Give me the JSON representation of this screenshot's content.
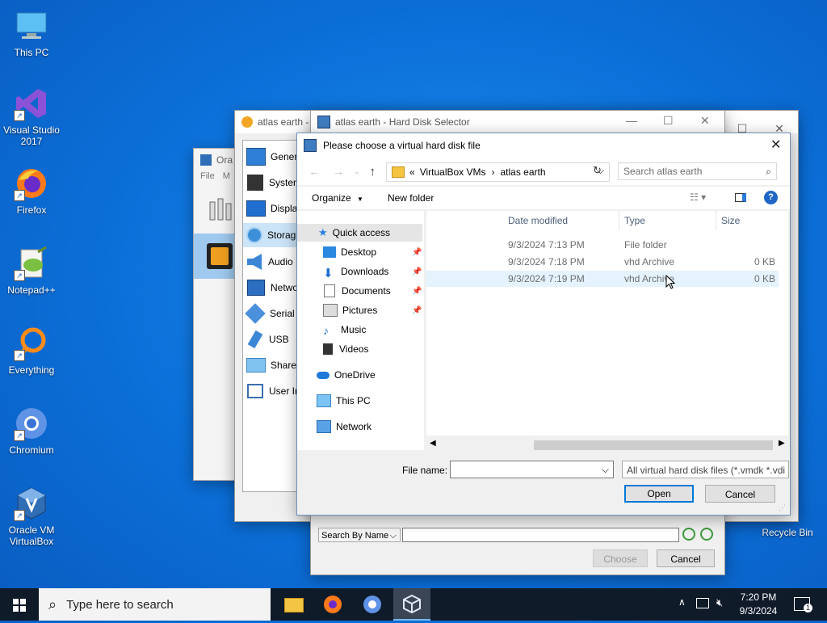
{
  "desktop": {
    "icons": [
      {
        "label": "This PC"
      },
      {
        "label": "Visual Studio 2017"
      },
      {
        "label": "Firefox"
      },
      {
        "label": "Notepad++"
      },
      {
        "label": "Everything"
      },
      {
        "label": "Chromium"
      },
      {
        "label": "Oracle VM VirtualBox"
      },
      {
        "label": "Recycle Bin"
      }
    ]
  },
  "vbox_manager": {
    "title": "Ora",
    "menu_file": "File",
    "menu_m": "M"
  },
  "settings_window": {
    "title": "atlas earth -",
    "sections": [
      "Genera",
      "System",
      "Display",
      "Storag",
      "Audio",
      "Netwo",
      "Serial P",
      "USB",
      "Shared",
      "User Ir"
    ]
  },
  "selector_window": {
    "title": "atlas earth - Hard Disk Selector",
    "search_mode": "Search By Name",
    "choose_label": "Choose",
    "cancel_label": "Cancel"
  },
  "dialog": {
    "title": "Please choose a virtual hard disk file",
    "breadcrumb": [
      "VirtualBox VMs",
      "atlas earth"
    ],
    "breadcrumb_prefix": "«",
    "search_placeholder": "Search atlas earth",
    "organize_label": "Organize",
    "new_folder_label": "New folder",
    "nav": [
      {
        "label": "Quick access"
      },
      {
        "label": "Desktop"
      },
      {
        "label": "Downloads"
      },
      {
        "label": "Documents"
      },
      {
        "label": "Pictures"
      },
      {
        "label": "Music"
      },
      {
        "label": "Videos"
      },
      {
        "label": "OneDrive"
      },
      {
        "label": "This PC"
      },
      {
        "label": "Network"
      }
    ],
    "columns": {
      "date": "Date modified",
      "type": "Type",
      "size": "Size"
    },
    "files": [
      {
        "date": "9/3/2024 7:13 PM",
        "type": "File folder",
        "size": ""
      },
      {
        "date": "9/3/2024 7:18 PM",
        "type": "vhd Archive",
        "size": "0 KB"
      },
      {
        "date": "9/3/2024 7:19 PM",
        "type": "vhd Archive",
        "size": "0 KB"
      }
    ],
    "filename_label": "File name:",
    "filename_value": "",
    "filter_value": "All virtual hard disk files (*.vmdk *.vdi *.vhd *.hdd",
    "open_label": "Open",
    "cancel_label": "Cancel"
  },
  "taskbar": {
    "search_placeholder": "Type here to search",
    "time": "7:20 PM",
    "date": "9/3/2024",
    "notification_count": "1"
  },
  "colors": {
    "accent": "#0078d7",
    "desktop": "#0b6fd8",
    "taskbar": "#101b2a",
    "selected_row": "#e5f3ff"
  }
}
